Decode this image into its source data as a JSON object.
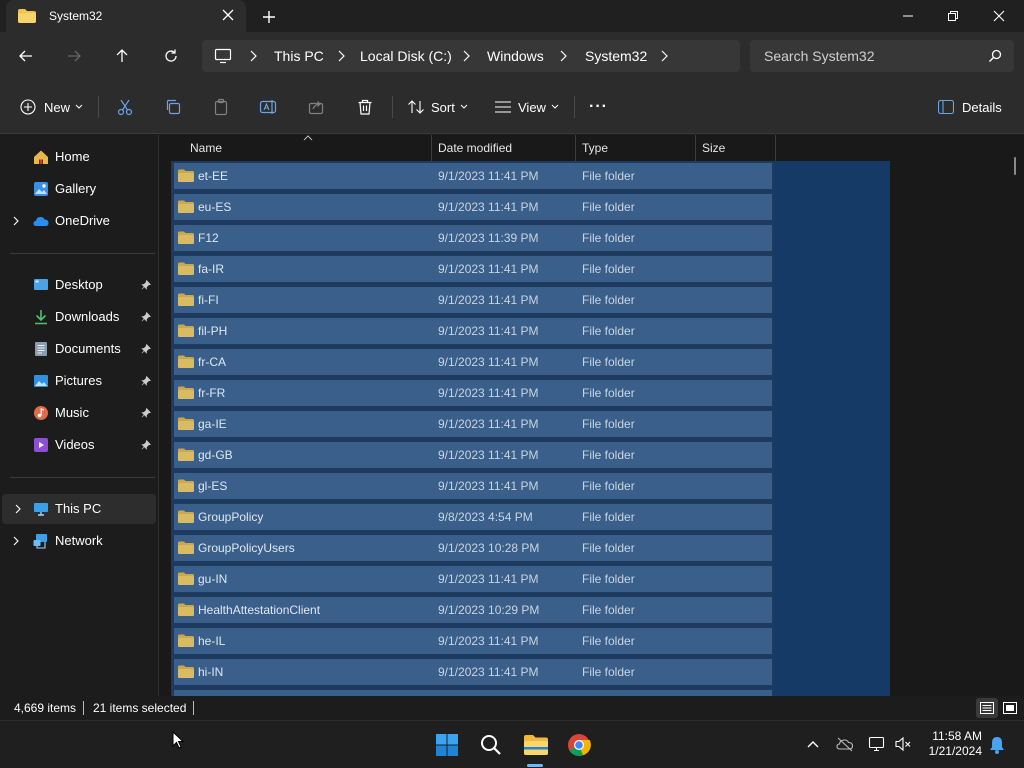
{
  "window": {
    "tab_title": "System32",
    "minimize_glyph": "—",
    "maximize_glyph": "❐",
    "close_glyph": "✕"
  },
  "address": {
    "breadcrumbs": [
      "This PC",
      "Local Disk (C:)",
      "Windows",
      "System32"
    ]
  },
  "search": {
    "placeholder": "Search System32"
  },
  "toolbar": {
    "new_label": "New",
    "sort_label": "Sort",
    "view_label": "View",
    "more_label": "···",
    "details_label": "Details"
  },
  "sidebar": {
    "quick": [
      {
        "label": "Home",
        "icon": "home-icon"
      },
      {
        "label": "Gallery",
        "icon": "gallery-icon"
      },
      {
        "label": "OneDrive",
        "icon": "onedrive-icon"
      }
    ],
    "pinned": [
      {
        "label": "Desktop",
        "icon": "desktop-icon"
      },
      {
        "label": "Downloads",
        "icon": "downloads-icon"
      },
      {
        "label": "Documents",
        "icon": "documents-icon"
      },
      {
        "label": "Pictures",
        "icon": "pictures-icon"
      },
      {
        "label": "Music",
        "icon": "music-icon"
      },
      {
        "label": "Videos",
        "icon": "videos-icon"
      }
    ],
    "locations": [
      {
        "label": "This PC",
        "icon": "this-pc-icon",
        "selected": true
      },
      {
        "label": "Network",
        "icon": "network-icon"
      }
    ]
  },
  "columns": {
    "name": "Name",
    "date": "Date modified",
    "type": "Type",
    "size": "Size"
  },
  "files": [
    {
      "name": "et-EE",
      "date": "9/1/2023 11:41 PM",
      "type": "File folder"
    },
    {
      "name": "eu-ES",
      "date": "9/1/2023 11:41 PM",
      "type": "File folder"
    },
    {
      "name": "F12",
      "date": "9/1/2023 11:39 PM",
      "type": "File folder"
    },
    {
      "name": "fa-IR",
      "date": "9/1/2023 11:41 PM",
      "type": "File folder"
    },
    {
      "name": "fi-FI",
      "date": "9/1/2023 11:41 PM",
      "type": "File folder"
    },
    {
      "name": "fil-PH",
      "date": "9/1/2023 11:41 PM",
      "type": "File folder"
    },
    {
      "name": "fr-CA",
      "date": "9/1/2023 11:41 PM",
      "type": "File folder"
    },
    {
      "name": "fr-FR",
      "date": "9/1/2023 11:41 PM",
      "type": "File folder"
    },
    {
      "name": "ga-IE",
      "date": "9/1/2023 11:41 PM",
      "type": "File folder"
    },
    {
      "name": "gd-GB",
      "date": "9/1/2023 11:41 PM",
      "type": "File folder"
    },
    {
      "name": "gl-ES",
      "date": "9/1/2023 11:41 PM",
      "type": "File folder"
    },
    {
      "name": "GroupPolicy",
      "date": "9/8/2023 4:54 PM",
      "type": "File folder"
    },
    {
      "name": "GroupPolicyUsers",
      "date": "9/1/2023 10:28 PM",
      "type": "File folder"
    },
    {
      "name": "gu-IN",
      "date": "9/1/2023 11:41 PM",
      "type": "File folder"
    },
    {
      "name": "HealthAttestationClient",
      "date": "9/1/2023 10:29 PM",
      "type": "File folder"
    },
    {
      "name": "he-IL",
      "date": "9/1/2023 11:41 PM",
      "type": "File folder"
    },
    {
      "name": "hi-IN",
      "date": "9/1/2023 11:41 PM",
      "type": "File folder"
    }
  ],
  "status": {
    "item_count": "4,669 items",
    "selected": "21 items selected"
  },
  "taskbar": {
    "time": "11:58 AM",
    "date": "1/21/2024",
    "apps": [
      "start-icon",
      "search-icon",
      "file-explorer-icon",
      "chrome-icon"
    ]
  },
  "colors": {
    "selected_row": "#3a5f8a",
    "accent": "#0078d4",
    "folder": "#e8b84a"
  }
}
